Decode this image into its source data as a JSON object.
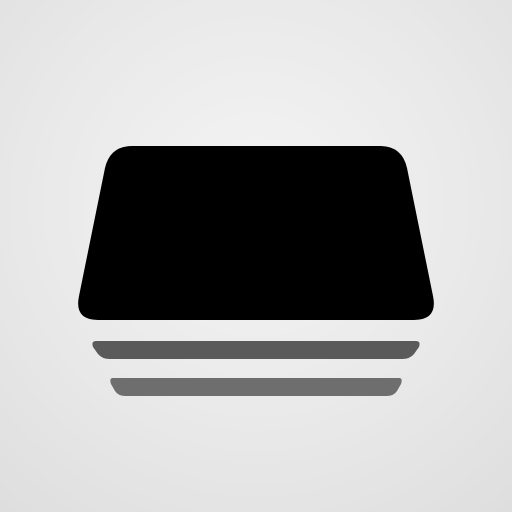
{
  "icon": {
    "name": "stacked-cards-icon",
    "colors": {
      "background": "#e8e8e8",
      "front_card": "#000000",
      "layer_1": "#5a5a5a",
      "layer_2": "#6e6e6e"
    }
  }
}
